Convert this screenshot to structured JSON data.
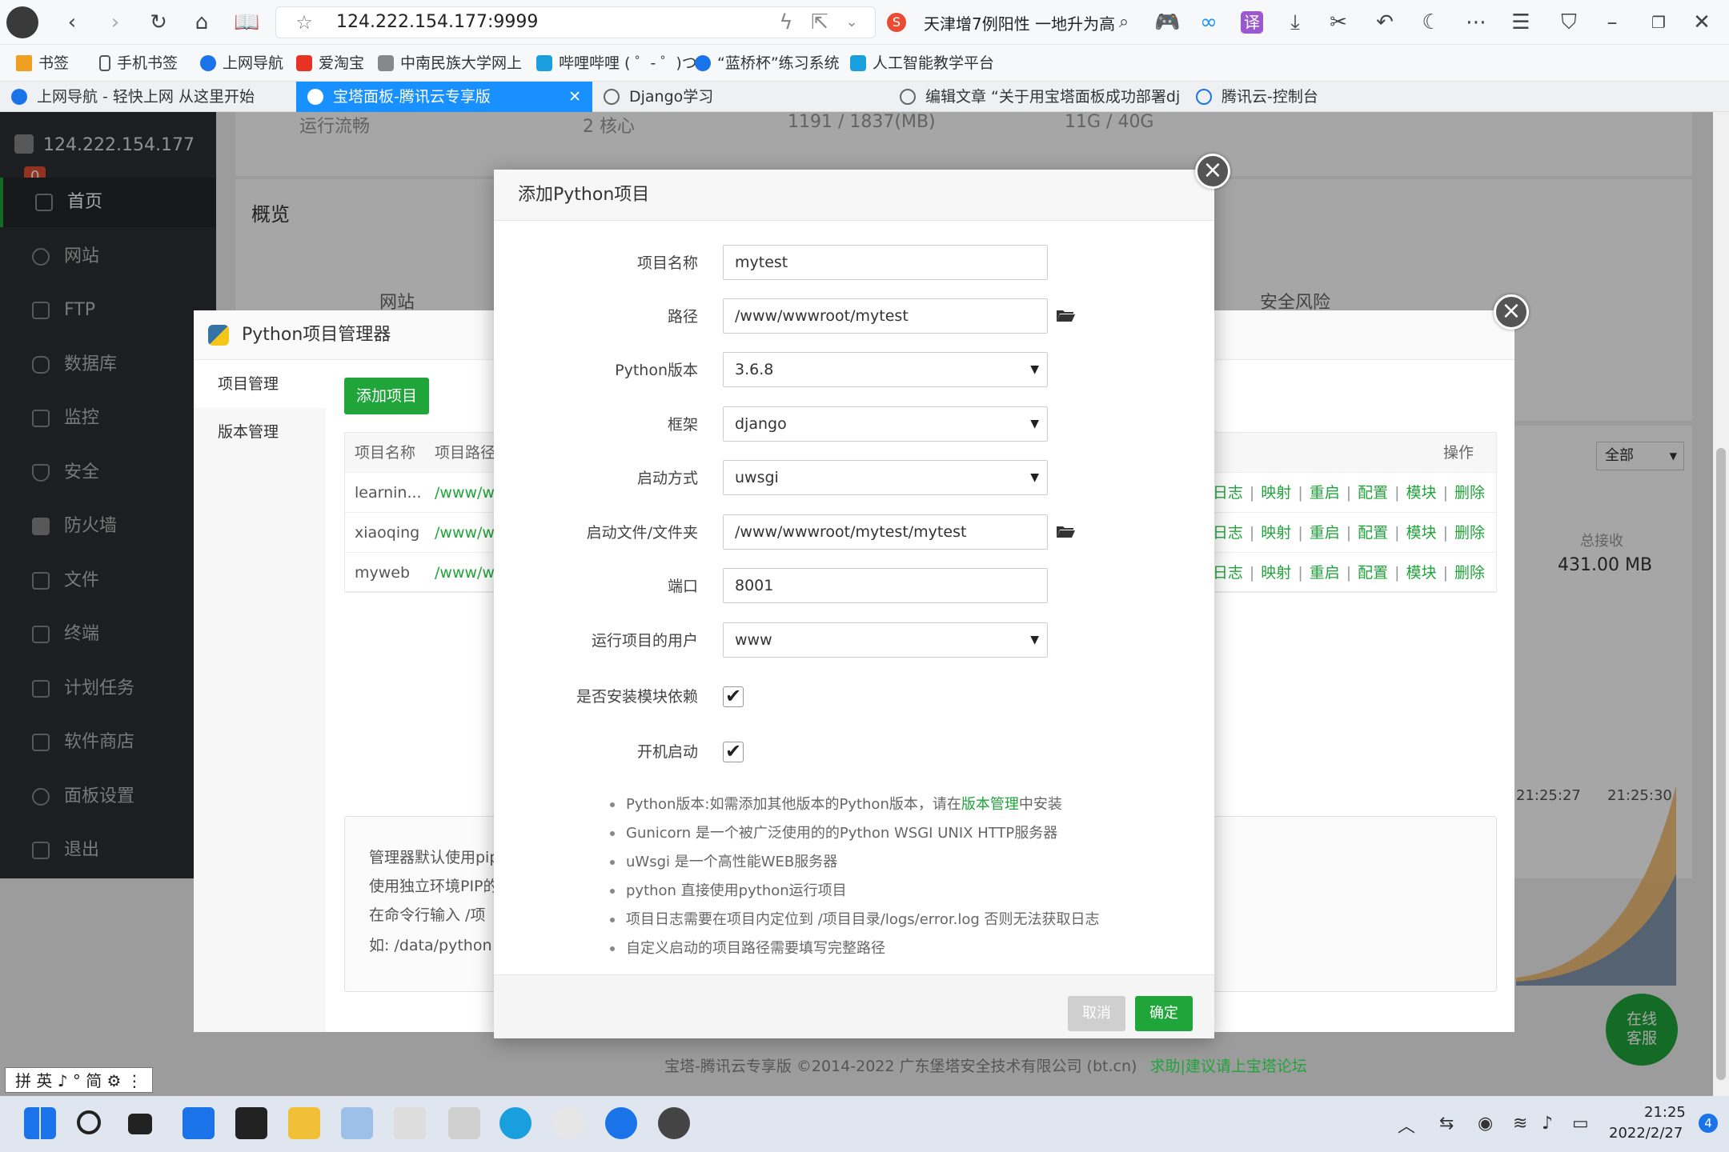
{
  "browser": {
    "url": "124.222.154.177:9999",
    "search_text": "天津增7例阳性 一地升为高",
    "bookmarks": [
      "书签",
      "手机书签",
      "上网导航",
      "爱淘宝",
      "中南民族大学网上",
      "哔哩哔哩 ( ゜- ゜)つ",
      "“蓝桥杯”练习系统",
      "人工智能教学平台"
    ],
    "tabs": [
      "上网导航 - 轻快上网 从这里开始",
      "宝塔面板-腾讯云专享版",
      "Django学习",
      "编辑文章 “关于用宝塔面板成功部署dj",
      "腾讯云-控制台"
    ],
    "new_tab": "+"
  },
  "sidebar": {
    "server": "124.222.154.177",
    "badge": "0",
    "items": [
      "首页",
      "网站",
      "FTP",
      "数据库",
      "监控",
      "安全",
      "防火墙",
      "文件",
      "终端",
      "计划任务",
      "软件商店",
      "面板设置",
      "退出"
    ]
  },
  "dashboard": {
    "status_row": [
      "运行流畅",
      "2 核心",
      "1191 / 1837(MB)",
      "11G / 40G"
    ],
    "overview": "概览",
    "overview_items": [
      "网站",
      "安全风险"
    ],
    "filter_select": "全部",
    "total_recv_label": "总接收",
    "total_recv_value": "431.00 MB",
    "chart_times": [
      "21:25:27",
      "21:25:30"
    ],
    "online_service": [
      "在线",
      "客服"
    ]
  },
  "footer": {
    "copyright": "宝塔-腾讯云专享版 ©2014-2022 广东堡塔安全技术有限公司 (bt.cn)",
    "link": "求助|建议请上宝塔论坛"
  },
  "python_manager": {
    "title": "Python项目管理器",
    "tabs": [
      "项目管理",
      "版本管理"
    ],
    "add_button": "添加项目",
    "columns": [
      "项目名称",
      "项目路径",
      "操作"
    ],
    "rows": [
      {
        "name": "learnin...",
        "path": "/www/w"
      },
      {
        "name": "xiaoqing",
        "path": "/www/w"
      },
      {
        "name": "myweb",
        "path": "/www/w"
      }
    ],
    "row_ops": [
      "日志",
      "映射",
      "重启",
      "配置",
      "模块",
      "删除"
    ],
    "note_lines": [
      "管理器默认使用pip",
      "使用独立环境PIP的",
      "在命令行输入  /项",
      "如:  /data/python"
    ]
  },
  "modal": {
    "title": "添加Python项目",
    "fields": [
      {
        "label": "项目名称",
        "value": "mytest"
      },
      {
        "label": "路径",
        "value": "/www/wwwroot/mytest"
      },
      {
        "label": "Python版本",
        "value": "3.6.8"
      },
      {
        "label": "框架",
        "value": "django"
      },
      {
        "label": "启动方式",
        "value": "uwsgi"
      },
      {
        "label": "启动文件/文件夹",
        "value": "/www/wwwroot/mytest/mytest"
      },
      {
        "label": "端口",
        "value": "8001"
      },
      {
        "label": "运行项目的用户",
        "value": "www"
      }
    ],
    "checks": [
      {
        "label": "是否安装模块依赖",
        "checked": true
      },
      {
        "label": "开机启动",
        "checked": true
      }
    ],
    "tips": {
      "t1_pre": "Python版本:如需添加其他版本的Python版本，请在",
      "t1_link": "版本管理",
      "t1_post": "中安装",
      "t2": "Gunicorn 是一个被广泛使用的的Python WSGI UNIX HTTP服务器",
      "t3": "uWsgi 是一个高性能WEB服务器",
      "t4": "python 直接使用python运行项目",
      "t5": "项目日志需要在项目内定位到 /项目目录/logs/error.log 否则无法获取日志",
      "t6": "自定义启动的项目路径需要填写完整路径"
    },
    "cancel": "取消",
    "confirm": "确定"
  },
  "taskbar": {
    "time": "21:25",
    "date": "2022/2/27",
    "notifications": "4",
    "ime": "拼 英 ♪ ° 简 ⚙ ⋮"
  },
  "colors": {
    "accent": "#20a53a",
    "tab_active": "#1890ff",
    "sidebar": "#2c2f33"
  }
}
